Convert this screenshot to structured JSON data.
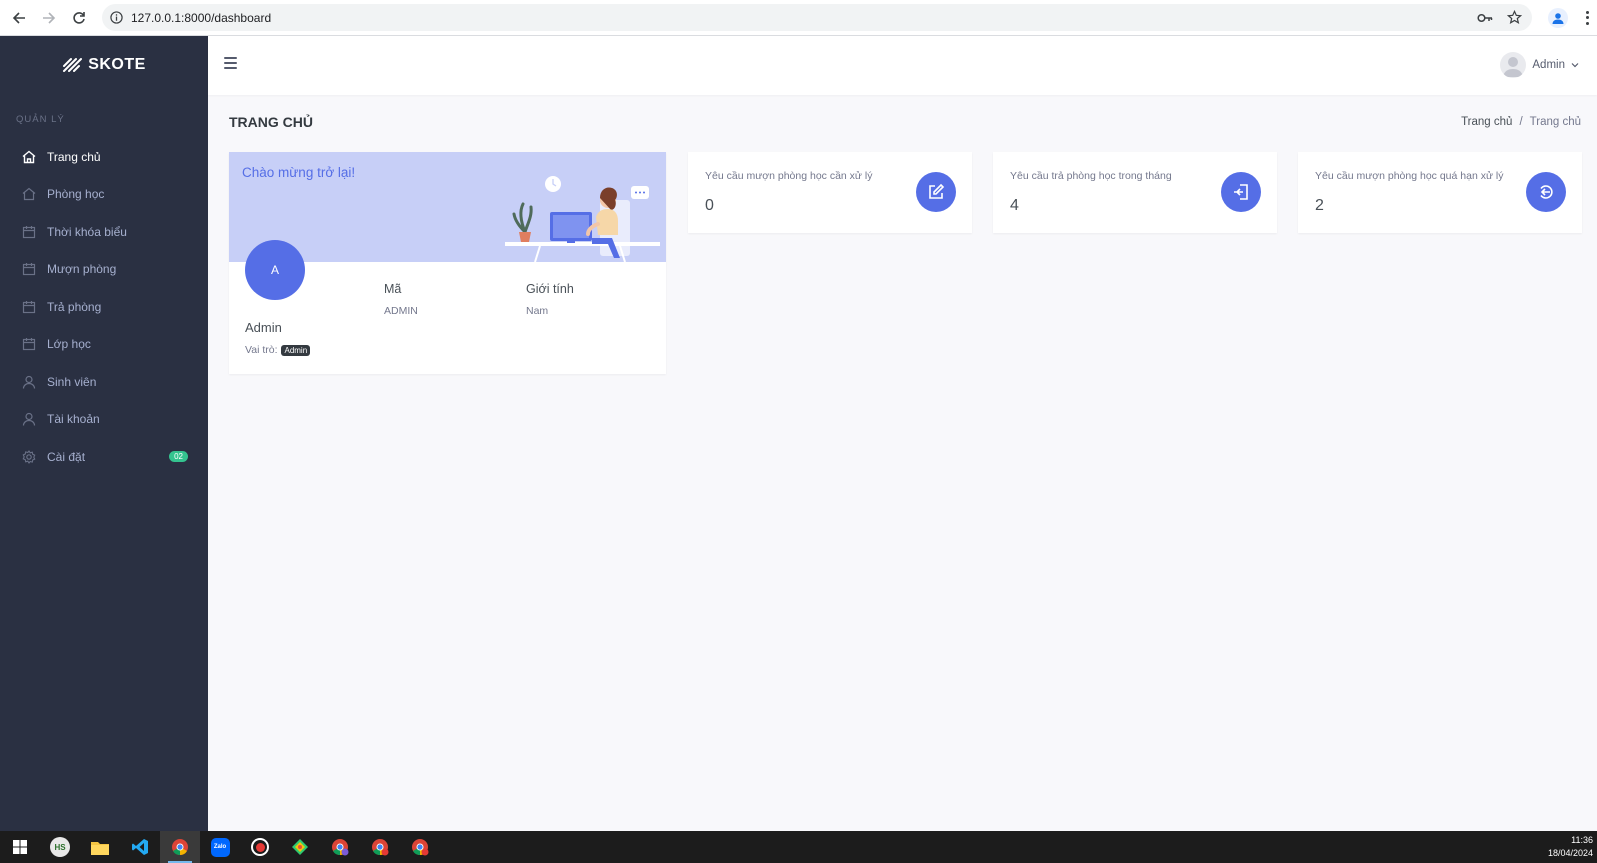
{
  "browser": {
    "url": "127.0.0.1:8000/dashboard"
  },
  "sidebar": {
    "logo": "SKOTE",
    "section_title": "QUẢN LÝ",
    "items": [
      {
        "label": "Trang chủ",
        "icon": "home-icon",
        "active": true
      },
      {
        "label": "Phòng học",
        "icon": "home-outline-icon"
      },
      {
        "label": "Thời khóa biểu",
        "icon": "calendar-icon"
      },
      {
        "label": "Mượn phòng",
        "icon": "calendar-icon"
      },
      {
        "label": "Trả phòng",
        "icon": "calendar-icon"
      },
      {
        "label": "Lớp học",
        "icon": "calendar-icon"
      },
      {
        "label": "Sinh viên",
        "icon": "user-icon"
      },
      {
        "label": "Tài khoản",
        "icon": "user-icon"
      },
      {
        "label": "Cài đặt",
        "icon": "gear-icon",
        "badge": "02"
      }
    ]
  },
  "topbar": {
    "user_name": "Admin"
  },
  "page": {
    "title": "TRANG CHỦ",
    "breadcrumb": [
      "Trang chủ",
      "Trang chủ"
    ]
  },
  "welcome": {
    "greeting": "Chào mừng trở lại!",
    "avatar_initial": "A",
    "name": "Admin",
    "role_label": "Vai trò:",
    "role": "Admin",
    "code_label": "Mã",
    "code_value": "ADMIN",
    "gender_label": "Giới tính",
    "gender_value": "Nam"
  },
  "stats": [
    {
      "label": "Yêu cầu mượn phòng học cần xử lý",
      "value": "0",
      "icon": "edit-icon"
    },
    {
      "label": "Yêu cầu trả phòng học trong tháng",
      "value": "4",
      "icon": "log-in-icon"
    },
    {
      "label": "Yêu cầu mượn phòng học quá hạn xử lý",
      "value": "2",
      "icon": "log-out-icon"
    }
  ],
  "taskbar": {
    "time": "11:36",
    "date": "18/04/2024"
  },
  "colors": {
    "sidebar_bg": "#2a3042",
    "primary": "#556ee6",
    "welcome_bg": "#c7cff7",
    "badge_green": "#34c38f"
  }
}
